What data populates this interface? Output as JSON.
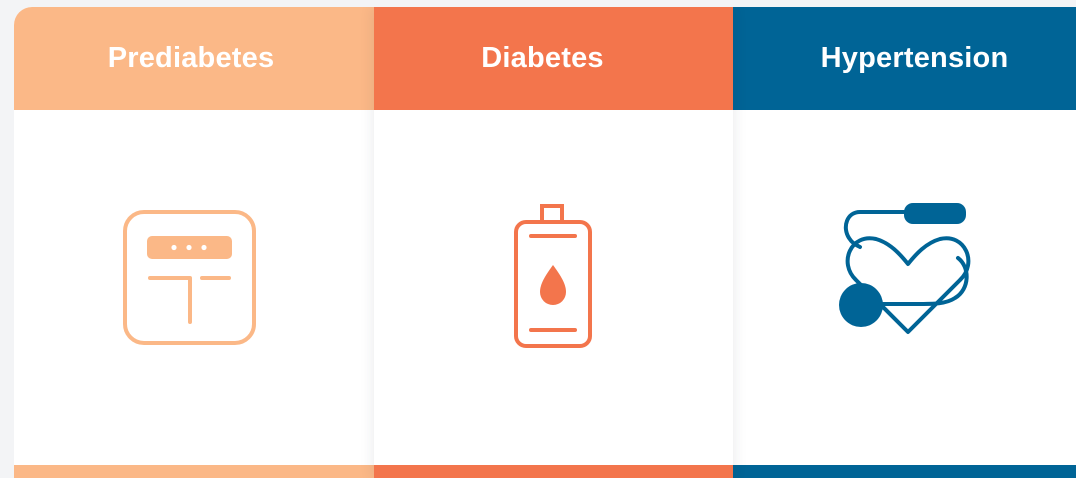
{
  "cards": [
    {
      "label": "Prediabetes",
      "icon": "glucose-meter-icon",
      "color": "#fbb887"
    },
    {
      "label": "Diabetes",
      "icon": "insulin-bottle-icon",
      "color": "#f3754c"
    },
    {
      "label": "Hypertension",
      "icon": "heart-monitor-icon",
      "color": "#006496"
    }
  ]
}
